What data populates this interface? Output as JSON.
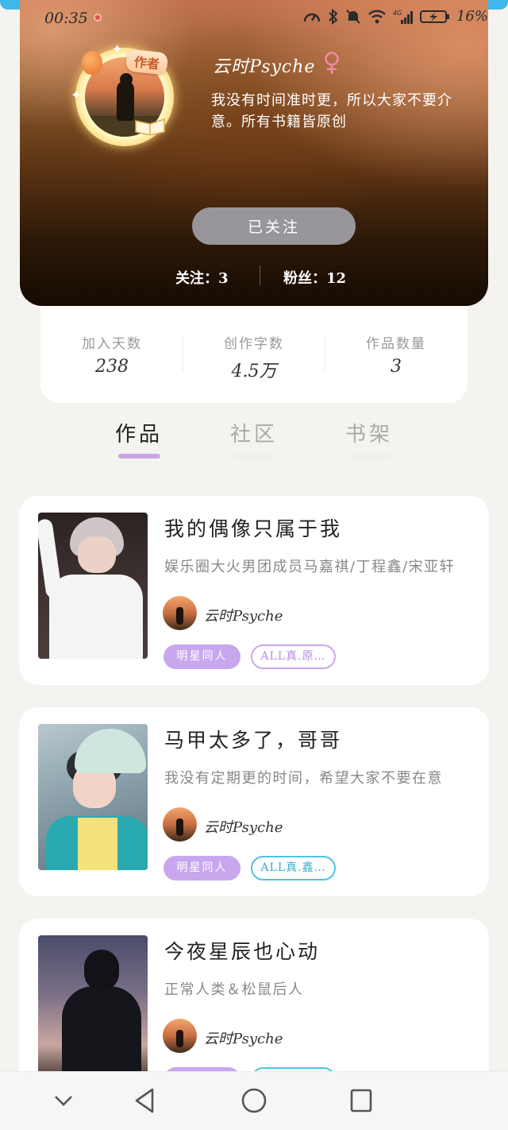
{
  "status_bar": {
    "time": "00:35",
    "battery_percent": "16%"
  },
  "profile": {
    "author_badge": "作者",
    "username": "云时Psyche",
    "bio": "我没有时间准时更，所以大家不要介意。所有书籍皆原创",
    "follow_button_label": "已关注",
    "following_label": "关注：3",
    "fans_label": "粉丝：12"
  },
  "stats": [
    {
      "label": "加入天数",
      "value": "238"
    },
    {
      "label": "创作字数",
      "value": "4.5万"
    },
    {
      "label": "作品数量",
      "value": "3"
    }
  ],
  "tabs": [
    {
      "label": "作品",
      "active": true
    },
    {
      "label": "社区",
      "active": false
    },
    {
      "label": "书架",
      "active": false
    }
  ],
  "books": [
    {
      "title": "我的偶像只属于我",
      "description": "娱乐圈大火男团成员马嘉祺/丁程鑫/宋亚轩",
      "author": "云时Psyche",
      "tag_primary": "明星同人",
      "tag_secondary": "ALL真.原…"
    },
    {
      "title": "马甲太多了，哥哥",
      "description": "我没有定期更的时间，希望大家不要在意",
      "author": "云时Psyche",
      "tag_primary": "明星同人",
      "tag_secondary": "ALL真.鑫…"
    },
    {
      "title": "今夜星辰也心动",
      "description": "正常人类＆松鼠后人",
      "author": "云时Psyche",
      "tag_primary": "",
      "tag_secondary": ""
    }
  ],
  "colors": {
    "accent_purple": "#c9a7ee",
    "accent_cyan": "#4cc3e0",
    "follow_button": "#98969a"
  },
  "icons": {
    "gender": "female-icon",
    "nav": [
      "collapse-down-icon",
      "back-triangle-icon",
      "home-circle-icon",
      "recents-square-icon"
    ]
  }
}
